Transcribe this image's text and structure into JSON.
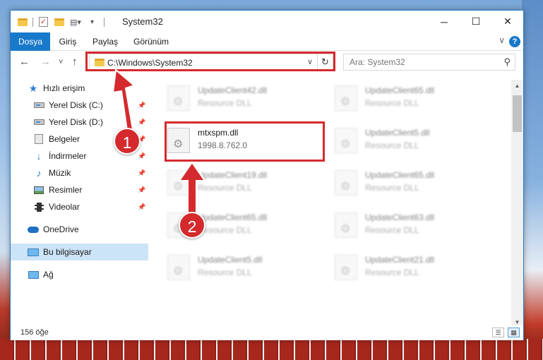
{
  "window": {
    "title": "System32",
    "controls": {
      "minimize": "─",
      "maximize": "☐",
      "close": "✕"
    }
  },
  "ribbon": {
    "tabs": [
      "Dosya",
      "Giriş",
      "Paylaş",
      "Görünüm"
    ],
    "active_tab": "Dosya",
    "help": "?"
  },
  "nav": {
    "back": "←",
    "forward": "→",
    "recent": "˅",
    "up": "↑",
    "address_path": "C:\\Windows\\System32",
    "refresh": "↻",
    "search_placeholder": "Ara: System32"
  },
  "sidebar": {
    "items": [
      {
        "label": "Hızlı erişim",
        "icon": "star-icon"
      },
      {
        "label": "Yerel Disk (C:)",
        "icon": "disk-icon",
        "pinned": true
      },
      {
        "label": "Yerel Disk (D:)",
        "icon": "disk-icon",
        "pinned": true
      },
      {
        "label": "Belgeler",
        "icon": "document-icon",
        "pinned": true
      },
      {
        "label": "İndirmeler",
        "icon": "download-icon",
        "pinned": true
      },
      {
        "label": "Müzik",
        "icon": "music-icon",
        "pinned": true
      },
      {
        "label": "Resimler",
        "icon": "pictures-icon",
        "pinned": true
      },
      {
        "label": "Videolar",
        "icon": "videos-icon",
        "pinned": true
      },
      {
        "label": "OneDrive",
        "icon": "onedrive-icon"
      },
      {
        "label": "Bu bilgisayar",
        "icon": "computer-icon",
        "selected": true
      },
      {
        "label": "Ağ",
        "icon": "network-icon"
      }
    ]
  },
  "files": [
    {
      "name": "UpdateClient42.dll",
      "sub": "Resource DLL"
    },
    {
      "name": "UpdateClient65.dll",
      "sub": "Resource DLL"
    },
    {
      "name": "mtxspm.dll",
      "sub": "1998.8.762.0",
      "highlighted": true
    },
    {
      "name": "UpdateClient5.dll",
      "sub": "Resource DLL"
    },
    {
      "name": "UpdateClient19.dll",
      "sub": "Resource DLL"
    },
    {
      "name": "UpdateClient65.dll",
      "sub": "Resource DLL"
    },
    {
      "name": "UpdateClient65.dll",
      "sub": "Resource DLL"
    },
    {
      "name": "UpdateClient63.dll",
      "sub": "Resource DLL"
    },
    {
      "name": "UpdateClient5.dll",
      "sub": "Resource DLL"
    },
    {
      "name": "UpdateClient21.dll",
      "sub": "Resource DLL"
    }
  ],
  "status": {
    "item_count": "156 öğe"
  },
  "annotations": {
    "step1": "1",
    "step2": "2",
    "color": "#d42a2e"
  }
}
